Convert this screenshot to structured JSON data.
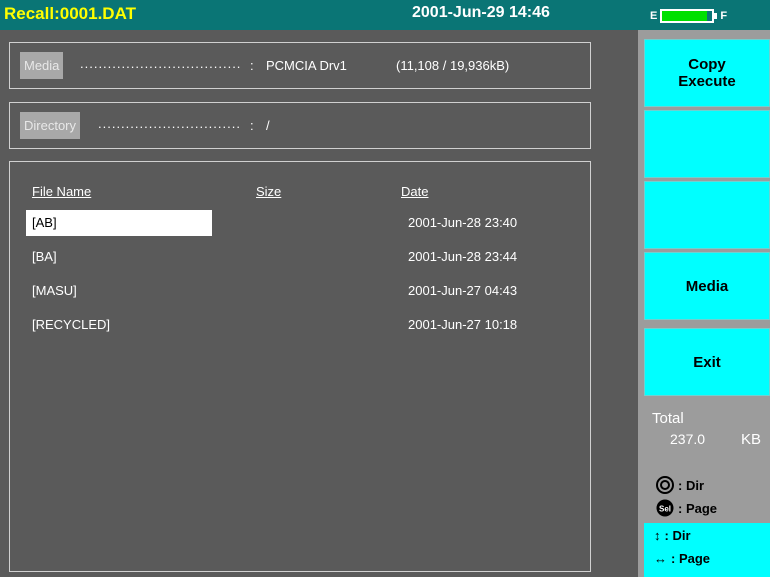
{
  "header": {
    "title": "Recall:0001.DAT",
    "datetime": "2001-Jun-29 14:46",
    "battery": {
      "empty_label": "E",
      "full_label": "F",
      "level": 0.9,
      "color": "#00e000"
    }
  },
  "media": {
    "tag": "Media",
    "dots": "...................................",
    "sep": ":",
    "value": "PCMCIA Drv1",
    "usage": "(11,108 / 19,936kB)"
  },
  "directory": {
    "tag": "Directory",
    "dots": "...............................",
    "sep": ":",
    "value": "/"
  },
  "file_list": {
    "columns": {
      "name": "File Name",
      "size": "Size",
      "date": "Date"
    },
    "rows": [
      {
        "name": "[AB]",
        "date": "2001-Jun-28 23:40",
        "selected": true
      },
      {
        "name": "[BA]",
        "date": "2001-Jun-28 23:44"
      },
      {
        "name": "[MASU]",
        "date": "2001-Jun-27 04:43"
      },
      {
        "name": "[RECYCLED]",
        "date": "2001-Jun-27 10:18"
      }
    ]
  },
  "softkeys": [
    {
      "line1": "Copy",
      "line2": "Execute"
    },
    {
      "line1": "",
      "line2": ""
    },
    {
      "line1": "",
      "line2": ""
    },
    {
      "line1": "Media",
      "line2": ""
    },
    {
      "line1": "Exit",
      "line2": ""
    }
  ],
  "total": {
    "label": "Total",
    "value": "237.0",
    "unit": "KB"
  },
  "legend": {
    "knob": ": Dir",
    "sel": ": Page",
    "updown": ": Dir",
    "leftright": ": Page"
  },
  "colors": {
    "topbar": "#0a7575",
    "title": "#ffff00",
    "softkey": "#00ffff",
    "panel": "#5a5a5a",
    "sidebar": "#9c9c9c"
  }
}
